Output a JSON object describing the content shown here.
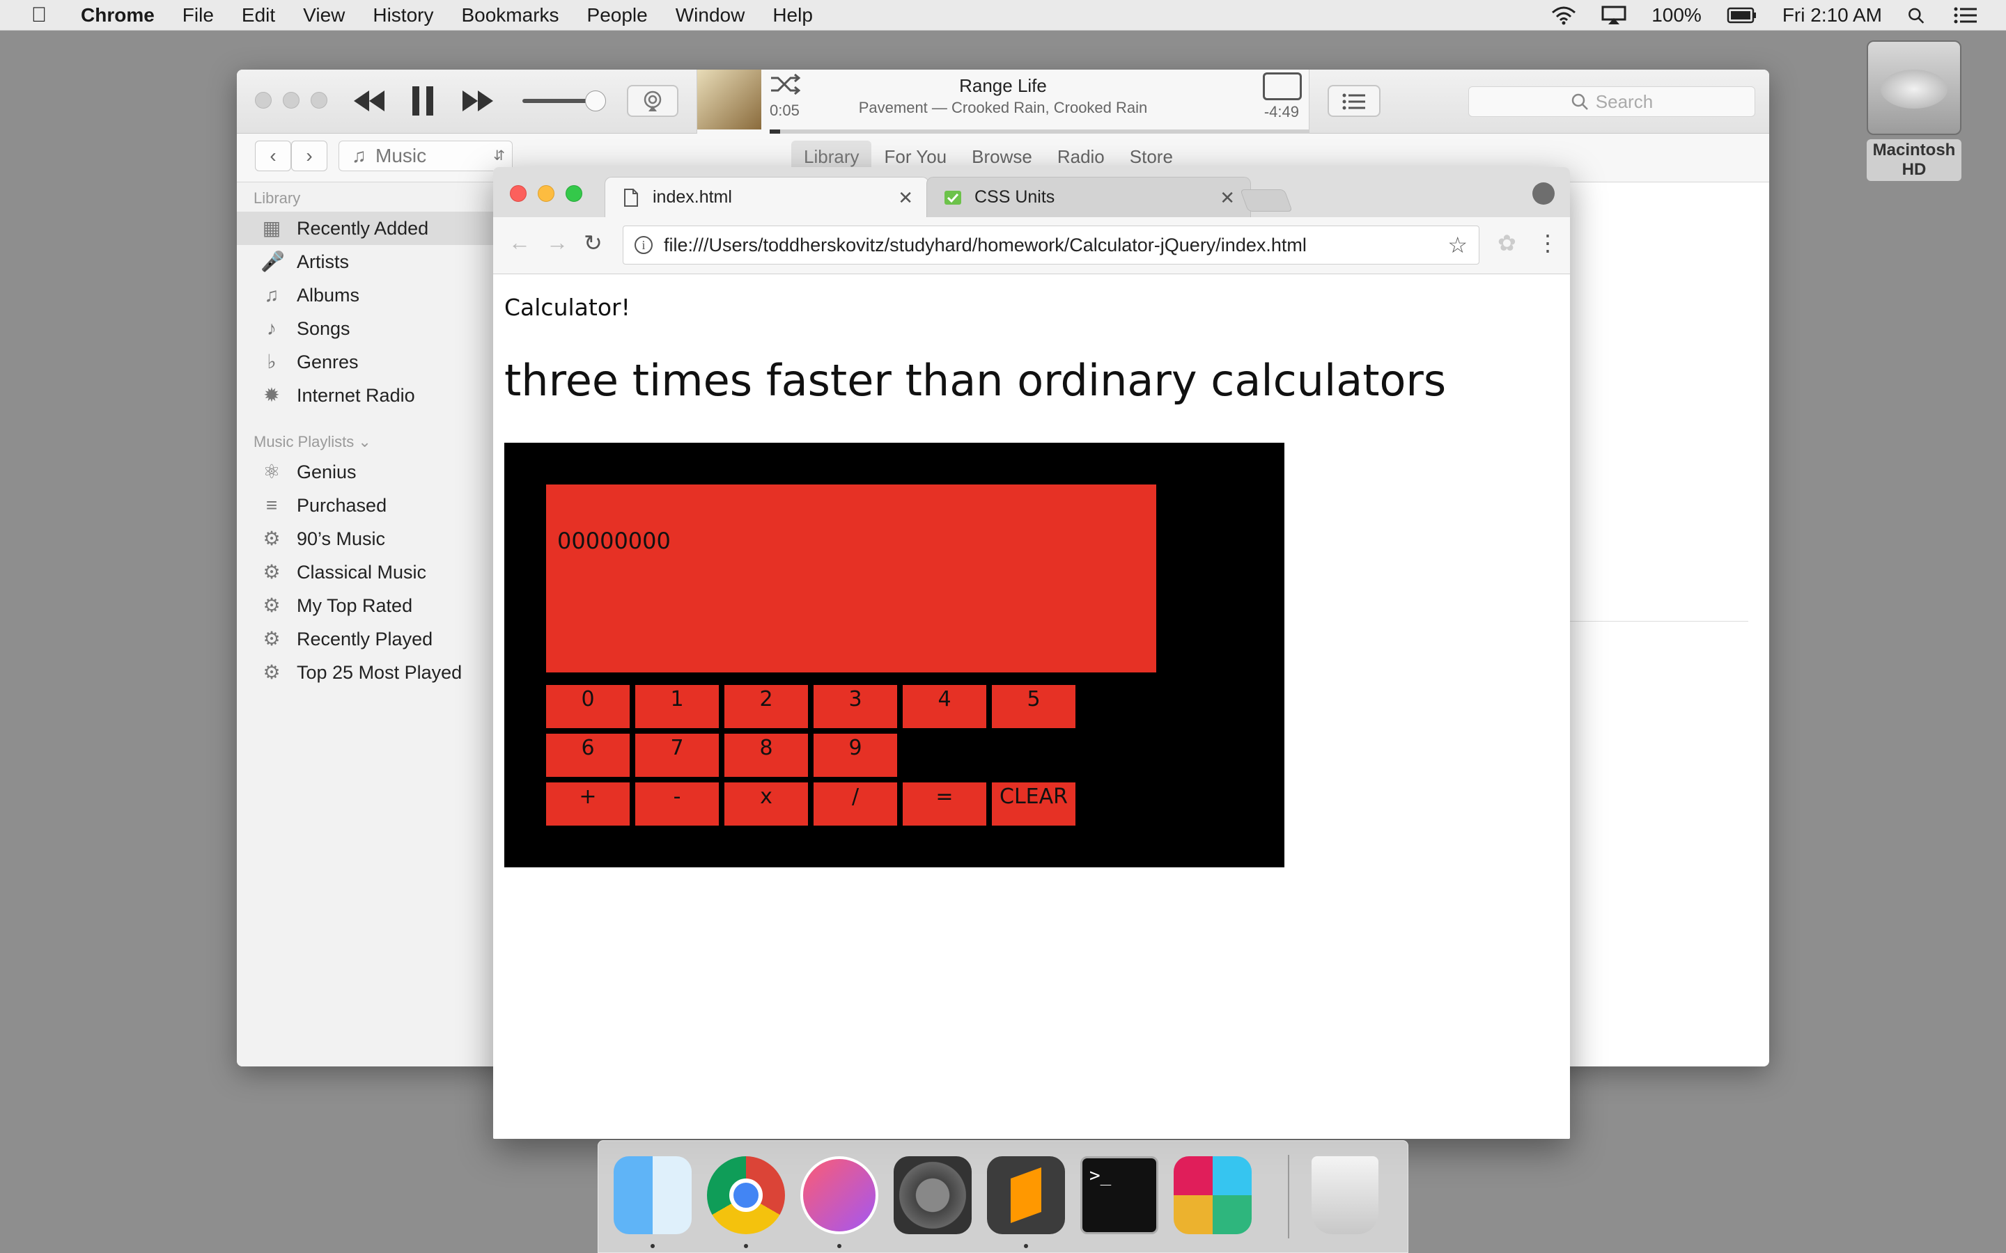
{
  "menubar": {
    "app": "Chrome",
    "items": [
      "File",
      "Edit",
      "View",
      "History",
      "Bookmarks",
      "People",
      "Window",
      "Help"
    ],
    "battery": "100%",
    "clock": "Fri 2:10 AM"
  },
  "desktop": {
    "drive_label": "Macintosh HD"
  },
  "itunes": {
    "track_title": "Range Life",
    "track_subtitle": "Pavement — Crooked Rain, Crooked Rain",
    "elapsed": "0:05",
    "remaining": "-4:49",
    "progress": 0.02,
    "search_placeholder": "Search",
    "source": "Music",
    "tabs": [
      "Library",
      "For You",
      "Browse",
      "Radio",
      "Store"
    ],
    "active_tab": "Library",
    "library_header": "Library",
    "library_items": [
      {
        "label": "Recently Added",
        "icon": "grid-icon"
      },
      {
        "label": "Artists",
        "icon": "microphone-icon"
      },
      {
        "label": "Albums",
        "icon": "album-icon"
      },
      {
        "label": "Songs",
        "icon": "note-icon"
      },
      {
        "label": "Genres",
        "icon": "genres-icon"
      },
      {
        "label": "Internet Radio",
        "icon": "antenna-icon"
      }
    ],
    "playlists_header": "Music Playlists",
    "playlist_items": [
      {
        "label": "Genius",
        "icon": "atom-icon"
      },
      {
        "label": "Purchased",
        "icon": "list-note-icon"
      },
      {
        "label": "90’s Music",
        "icon": "gear-icon"
      },
      {
        "label": "Classical Music",
        "icon": "gear-icon"
      },
      {
        "label": "My Top Rated",
        "icon": "gear-icon"
      },
      {
        "label": "Recently Played",
        "icon": "gear-icon"
      },
      {
        "label": "Top 25 Most Played",
        "icon": "gear-icon"
      }
    ]
  },
  "chrome": {
    "tabs": [
      {
        "title": "index.html",
        "active": true
      },
      {
        "title": "CSS Units",
        "active": false
      }
    ],
    "url": "file:///Users/toddherskovitz/studyhard/homework/Calculator-jQuery/index.html"
  },
  "page": {
    "heading_small": "Calculator!",
    "heading_large": "three times faster than ordinary calculators",
    "display_value": "00000000",
    "keys_row1": [
      "0",
      "1",
      "2",
      "3",
      "4",
      "5"
    ],
    "keys_row2": [
      "6",
      "7",
      "8",
      "9"
    ],
    "keys_row3": [
      "+",
      "-",
      "x",
      "/",
      "=",
      "CLEAR"
    ],
    "colors": {
      "calc_bg": "#000000",
      "calc_red": "#e63125"
    }
  },
  "dock": {
    "apps": [
      "finder-icon",
      "chrome-icon",
      "itunes-icon",
      "system-preferences-icon",
      "sublime-text-icon",
      "terminal-icon",
      "slack-icon",
      "trash-icon"
    ]
  }
}
